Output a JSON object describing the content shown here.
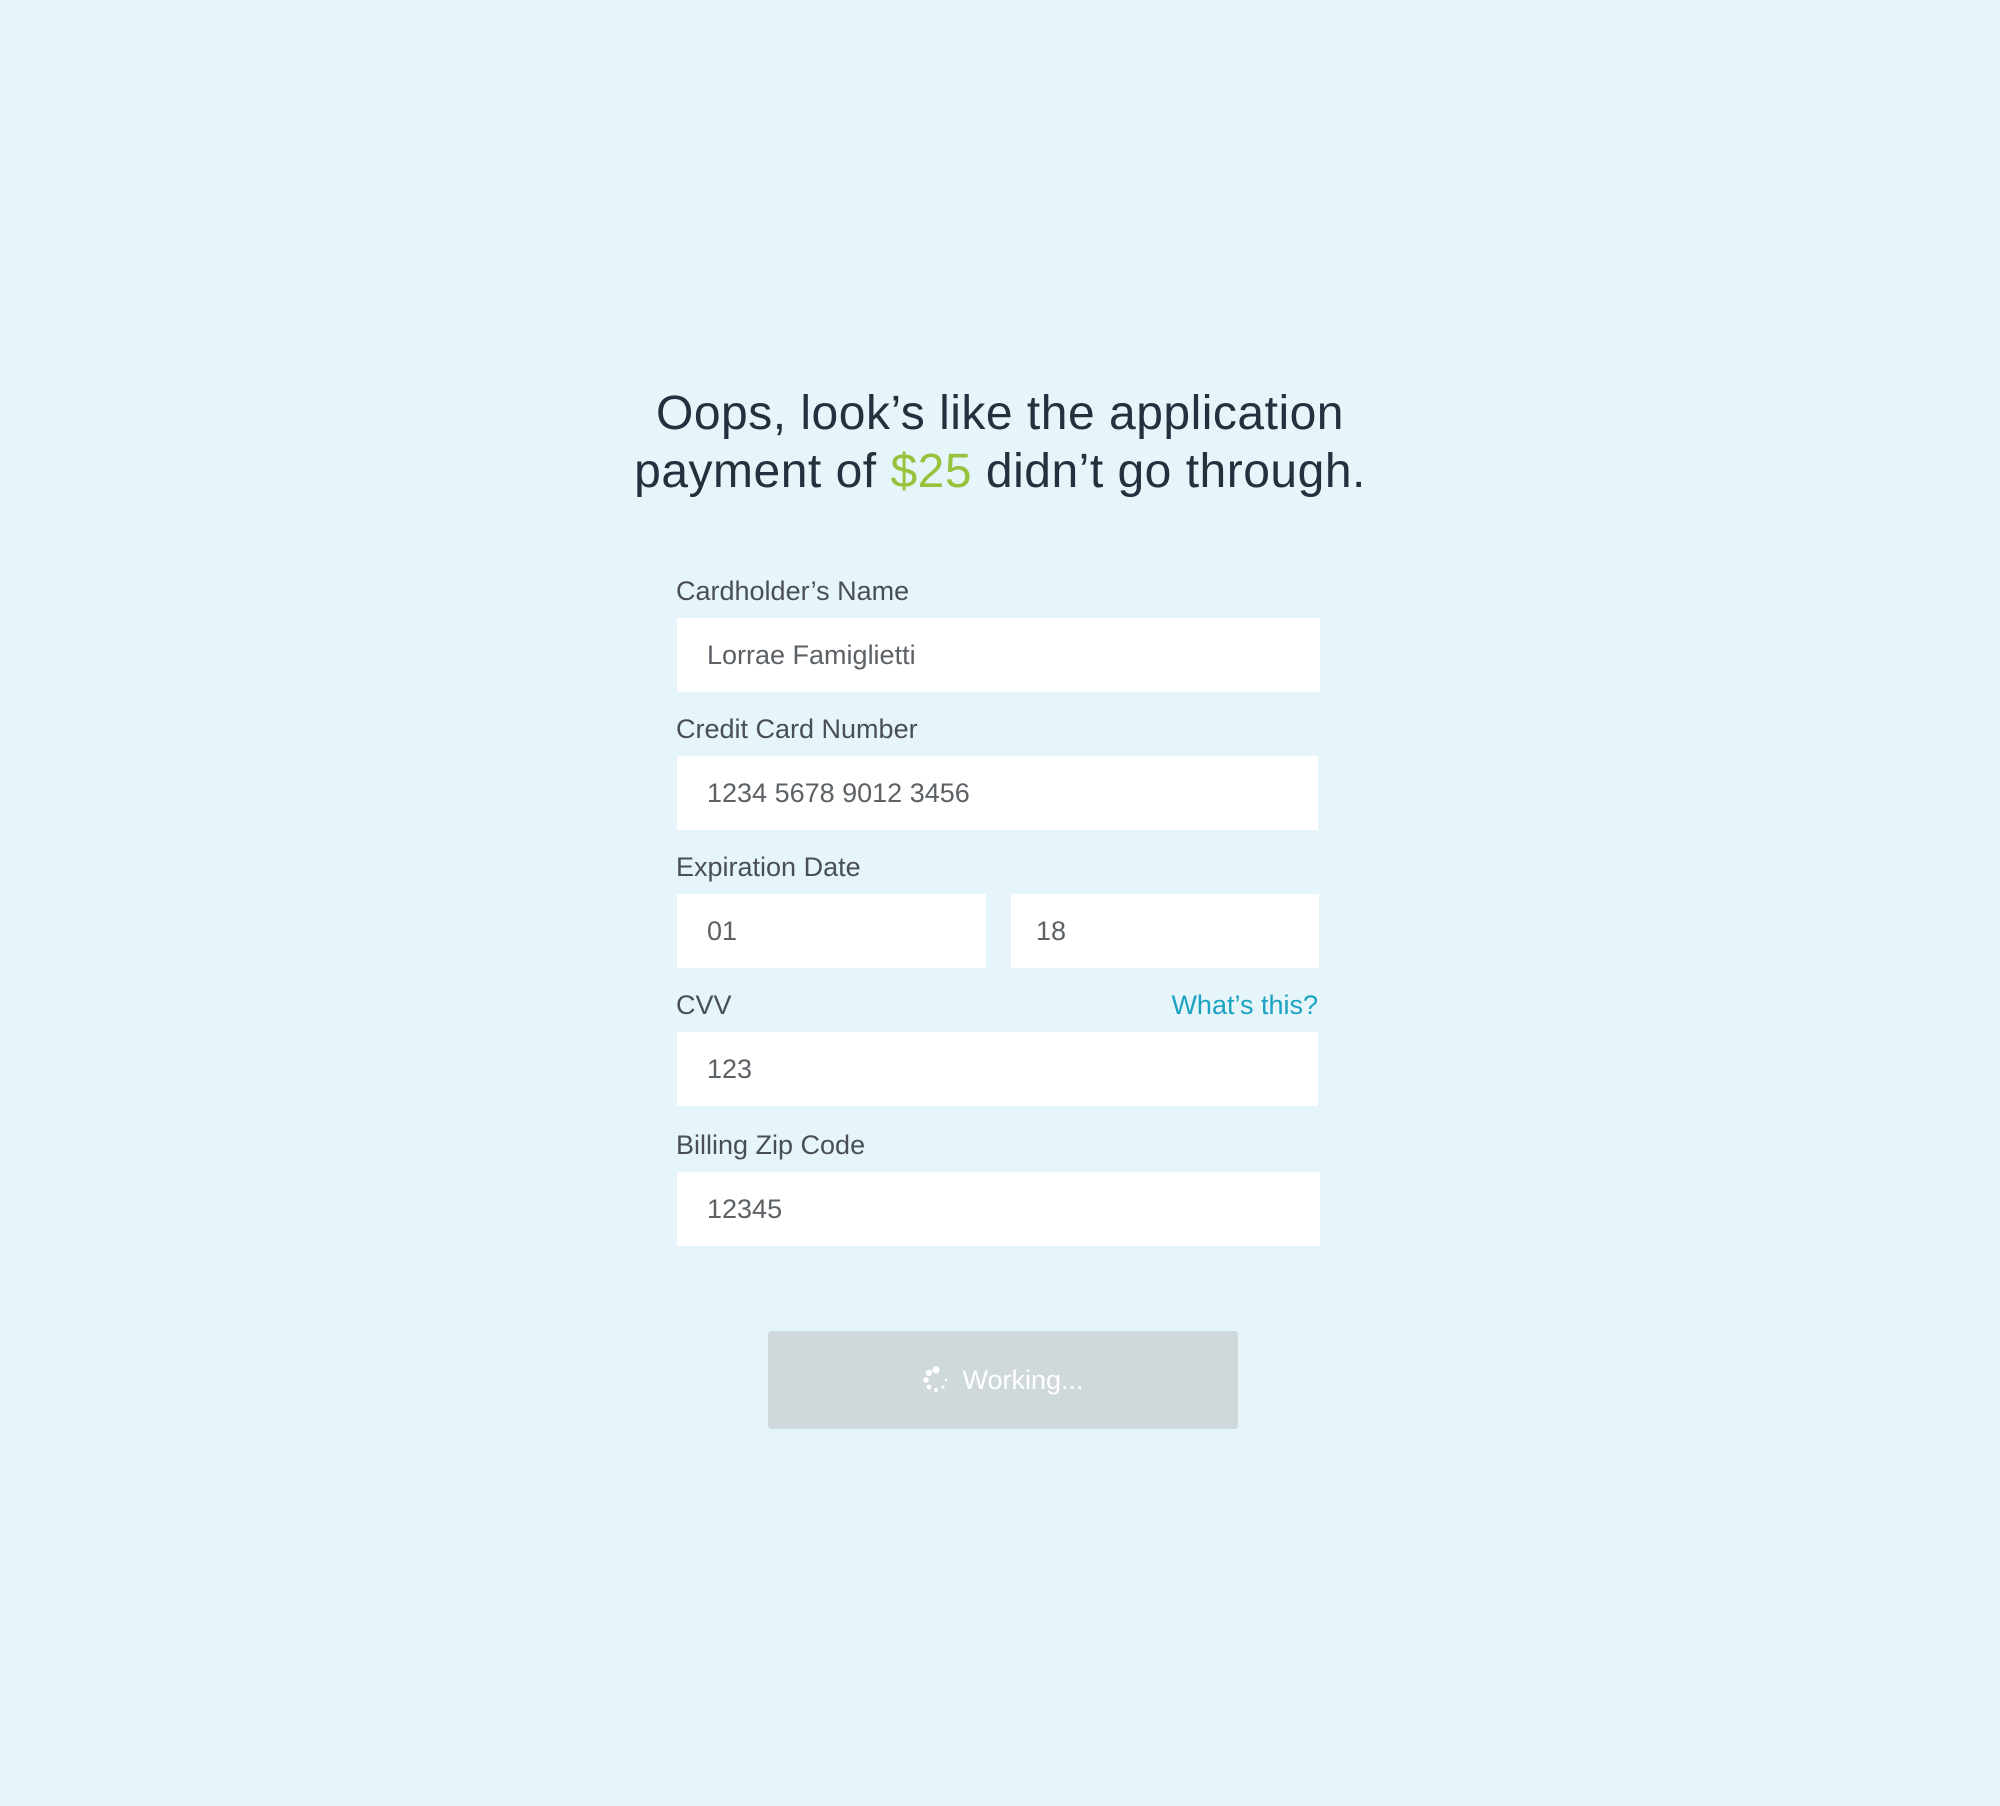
{
  "headline": {
    "line1": "Oops, look’s like the application",
    "line2_prefix": "payment of ",
    "amount": "$25",
    "line2_suffix": " didn’t go through."
  },
  "form": {
    "cardholder_label": "Cardholder’s Name",
    "cardholder_value": "Lorrae Famiglietti",
    "card_number_label": "Credit Card Number",
    "card_number_value": "1234 5678 9012 3456",
    "expiration_label": "Expiration Date",
    "exp_month_value": "01",
    "exp_year_value": "18",
    "cvv_label": "CVV",
    "cvv_help_link": "What’s this?",
    "cvv_value": "123",
    "zip_label": "Billing Zip Code",
    "zip_value": "12345"
  },
  "submit": {
    "label": "Working...",
    "icon": "spinner-icon",
    "state": "disabled"
  },
  "colors": {
    "background": "#e5f5fa",
    "accent_green": "#97c23c",
    "link_blue": "#1ba1c1",
    "button_disabled": "#cfd9dc",
    "text_dark": "#262f3d"
  }
}
